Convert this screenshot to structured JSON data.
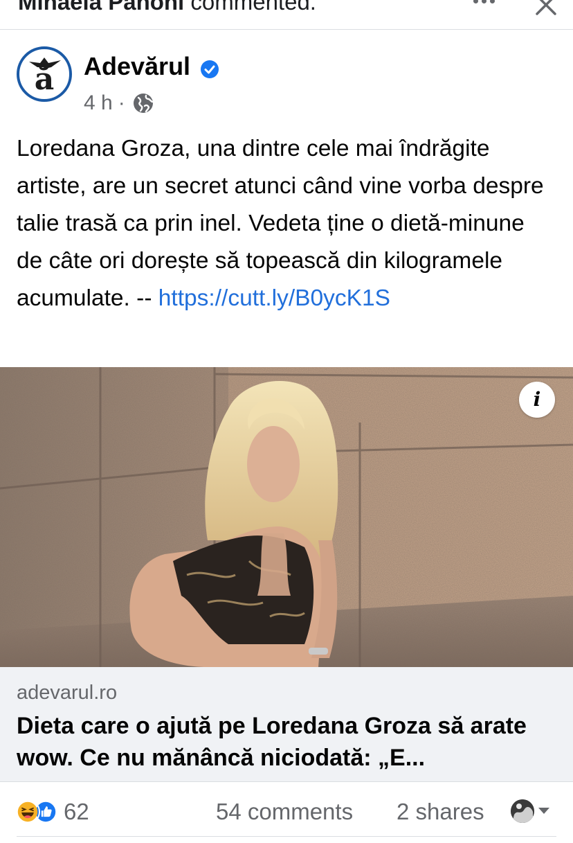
{
  "topbar": {
    "actor": "Mihaela Pahoni",
    "action": "commented."
  },
  "post": {
    "page_name": "Adevărul",
    "avatar_letter": "ă",
    "verified": true,
    "time": "4 h",
    "separator": "·",
    "audience_icon": "globe-icon",
    "text": "Loredana Groza, una dintre cele mai îndrăgite artiste, are un secret atunci când vine vorba despre talie trasă ca prin inel. Vedeta ține o dietă-minune de câte ori dorește să topească din kilogramele acumulate. -- ",
    "link": "https://cutt.ly/B0ycK1S"
  },
  "link_preview": {
    "info_label": "i",
    "domain": "adevarul.ro",
    "headline": "Dieta care o ajută pe Loredana Groza să arate wow. Ce nu mănâncă niciodată: „E..."
  },
  "engagement": {
    "reaction_icons": [
      "haha-icon",
      "like-icon"
    ],
    "reaction_count": "62",
    "comments": "54 comments",
    "shares": "2 shares"
  },
  "colors": {
    "link": "#216fdb",
    "verified": "#1877f2",
    "secondary_text": "#65676b",
    "card_bg": "#f0f2f5"
  }
}
